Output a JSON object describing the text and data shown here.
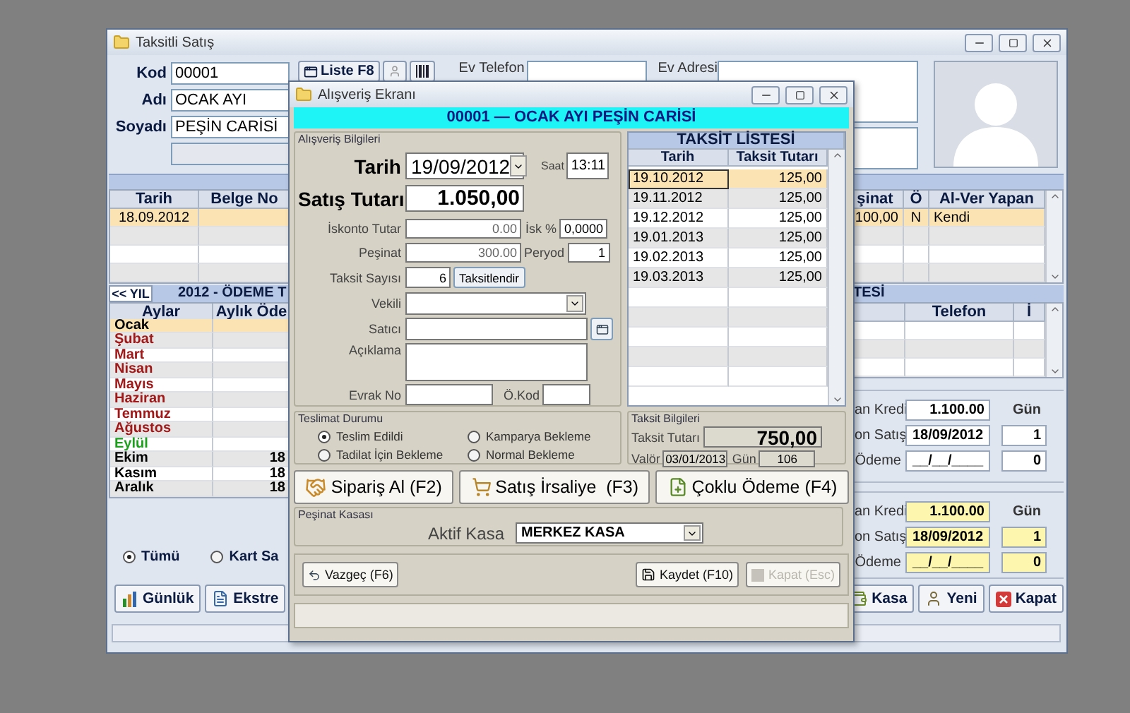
{
  "main_window": {
    "title": "Taksitli Satış",
    "customer_fields": [
      {
        "label": "Kod",
        "value": "00001"
      },
      {
        "label": "Adı",
        "value": "OCAK AYI"
      },
      {
        "label": "Soyadı",
        "value": "PEŞİN CARİSİ"
      }
    ],
    "list_button": "Liste F8",
    "ev_telefon_label": "Ev Telefon",
    "ev_adresi_label": "Ev Adresi",
    "sales_table": {
      "columns": [
        "Tarih",
        "Belge No",
        "şinat",
        "Ö",
        "Al-Ver Yapan"
      ],
      "rows": [
        {
          "tarih": "18.09.2012",
          "column_3": "100,00",
          "column_4": "N",
          "column_5": "Kendi",
          "selected": true
        }
      ]
    },
    "calendar": {
      "back_button": "<< YIL",
      "title": "2012 - ÖDEME T",
      "columns": [
        "Aylar",
        "Aylık Öde"
      ],
      "months": [
        {
          "name": "Ocak",
          "color": "#000000",
          "selected": true
        },
        {
          "name": "Şubat",
          "color": "#a01818",
          "selected": false
        },
        {
          "name": "Mart",
          "color": "#a01818",
          "selected": false
        },
        {
          "name": "Nisan",
          "color": "#a01818",
          "selected": false
        },
        {
          "name": "Mayıs",
          "color": "#a01818",
          "selected": false
        },
        {
          "name": "Haziran",
          "color": "#a01818",
          "selected": false
        },
        {
          "name": "Temmuz",
          "color": "#a01818",
          "selected": false
        },
        {
          "name": "Ağustos",
          "color": "#a01818",
          "selected": false
        },
        {
          "name": "Eylül",
          "color": "#1ea01e",
          "selected": false
        },
        {
          "name": "Ekim",
          "color": "#000000",
          "value": "18",
          "selected": false
        },
        {
          "name": "Kasım",
          "color": "#000000",
          "value": "18",
          "selected": false
        },
        {
          "name": "Aralık",
          "color": "#000000",
          "value": "18",
          "selected": false
        }
      ]
    },
    "filter": [
      {
        "label": "Tümü",
        "selected": true
      },
      {
        "label": "Kart Sa",
        "selected": false
      }
    ],
    "contact_list": {
      "title": "TESİ",
      "columns": [
        "Telefon",
        "İ"
      ]
    },
    "credit_panels": [
      {
        "kind": "plain",
        "days_label": "Gün",
        "rows": [
          {
            "label": "an Kredi",
            "value": "1.100.00"
          },
          {
            "label": "on Satış",
            "value": "18/09/2012",
            "days": "1"
          },
          {
            "label": "Ödeme",
            "value": "__/__/____",
            "days": "0"
          }
        ]
      },
      {
        "kind": "highlighted",
        "days_label": "Gün",
        "rows": [
          {
            "label": "an Kredi",
            "value": "1.100.00"
          },
          {
            "label": "on Satış",
            "value": "18/09/2012",
            "days": "1"
          },
          {
            "label": "Ödeme",
            "value": "__/__/____",
            "days": "0"
          }
        ]
      }
    ],
    "left_buttons": [
      {
        "label": "Günlük",
        "kind": "chart"
      },
      {
        "label": "Ekstre",
        "kind": "document"
      }
    ],
    "right_buttons": [
      {
        "label": "Kasa",
        "kind": "cash"
      },
      {
        "label": "Yeni",
        "kind": "person"
      },
      {
        "label": "Kapat",
        "kind": "close"
      }
    ]
  },
  "dialog": {
    "title": "Alışveriş Ekranı",
    "header": "00001 — OCAK AYI PEŞİN CARİSİ",
    "info_group": {
      "title": "Alışveriş Bilgileri",
      "tarih_label": "Tarih",
      "tarih": "19/09/2012",
      "saat_label": "Saat",
      "saat": "13:11",
      "satis_tutari_label": "Satış Tutarı",
      "satis_tutari": "1.050,00",
      "iskonto_label": "İskonto Tutar",
      "iskonto": "0.00",
      "isk_pct_label": "İsk %",
      "isk_pct": "0,0000",
      "pesinat_label": "Peşinat",
      "pesinat": "300.00",
      "peryod_label": "Peryod",
      "peryod": "1",
      "taksit_sayisi_label": "Taksit Sayısı",
      "taksit_sayisi": "6",
      "taksitlendir_button": "Taksitlendir",
      "vekili_label": "Vekili",
      "satici_label": "Satıcı",
      "aciklama_label": "Açıklama",
      "evrak_no_label": "Evrak No",
      "o_kod_label": "Ö.Kod"
    },
    "installments": {
      "title": "TAKSİT LİSTESİ",
      "columns": [
        "Tarih",
        "Taksit Tutarı"
      ],
      "rows": [
        {
          "tarih": "19.10.2012",
          "tutar": "125,00",
          "selected": true
        },
        {
          "tarih": "19.11.2012",
          "tutar": "125,00",
          "selected": false
        },
        {
          "tarih": "19.12.2012",
          "tutar": "125,00",
          "selected": false
        },
        {
          "tarih": "19.01.2013",
          "tutar": "125,00",
          "selected": false
        },
        {
          "tarih": "19.02.2013",
          "tutar": "125,00",
          "selected": false
        },
        {
          "tarih": "19.03.2013",
          "tutar": "125,00",
          "selected": false
        }
      ]
    },
    "delivery": {
      "title": "Teslimat Durumu",
      "options": [
        {
          "label": "Teslim Edildi",
          "selected": true
        },
        {
          "label": "Kamparya Bekleme",
          "selected": false
        },
        {
          "label": "Tadilat İçin Bekleme",
          "selected": false
        },
        {
          "label": "Normal Bekleme",
          "selected": false
        }
      ]
    },
    "installment_info": {
      "title": "Taksit Bilgileri",
      "taksit_tutari_label": "Taksit Tutarı",
      "taksit_tutari": "750,00",
      "valor_label": "Valör",
      "valor": "03/01/2013",
      "gun_label": "Gün",
      "gun": "106"
    },
    "action_buttons": [
      {
        "label": "Sipariş Al (F2)",
        "kind": "order"
      },
      {
        "label": "Satış İrsaliye  (F3)",
        "kind": "waybill"
      },
      {
        "label": "Çoklu Ödeme (F4)",
        "kind": "payment"
      }
    ],
    "cash": {
      "title": "Peşinat Kasası",
      "label": "Aktif Kasa",
      "value": "MERKEZ KASA"
    },
    "cancel_button": "Vazgeç (F6)",
    "save_button": "Kaydet (F10)",
    "close_button": {
      "label": "Kapat (Esc)",
      "disabled": true
    }
  }
}
